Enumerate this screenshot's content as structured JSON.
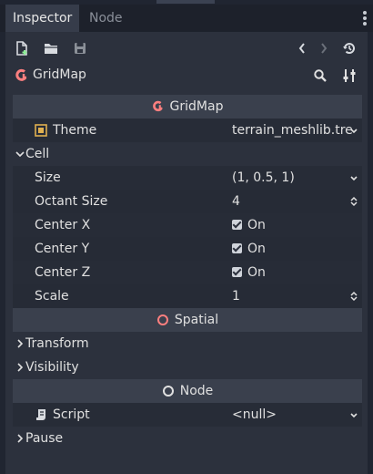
{
  "tabs": [
    {
      "label": "Inspector",
      "active": true
    },
    {
      "label": "Node",
      "active": false
    }
  ],
  "toolbar": {
    "icons": [
      "new-script-icon",
      "open-folder-icon",
      "save-icon",
      "history-back-icon",
      "history-forward-icon",
      "history-icon"
    ]
  },
  "object": {
    "label": "GridMap",
    "icons": [
      "search-icon",
      "property-tools-icon"
    ]
  },
  "sections": {
    "gridmap": "GridMap",
    "theme_label": "Theme",
    "theme_value": "terrain_meshlib.tre",
    "cell_group": "Cell",
    "size_label": "Size",
    "size_value": "(1, 0.5, 1)",
    "octant_label": "Octant Size",
    "octant_value": "4",
    "center_x_label": "Center X",
    "center_x_value": "On",
    "center_y_label": "Center Y",
    "center_y_value": "On",
    "center_z_label": "Center Z",
    "center_z_value": "On",
    "scale_label": "Scale",
    "scale_value": "1",
    "spatial": "Spatial",
    "transform_group": "Transform",
    "visibility_group": "Visibility",
    "node": "Node",
    "script_label": "Script",
    "script_value": "<null>",
    "pause_group": "Pause"
  },
  "colors": {
    "accent_gridmap": "#fc7f7f",
    "spatial_ring": "#fc7f7f",
    "node_ring": "#e0e0e0",
    "theme_icon": "#e0b050"
  }
}
